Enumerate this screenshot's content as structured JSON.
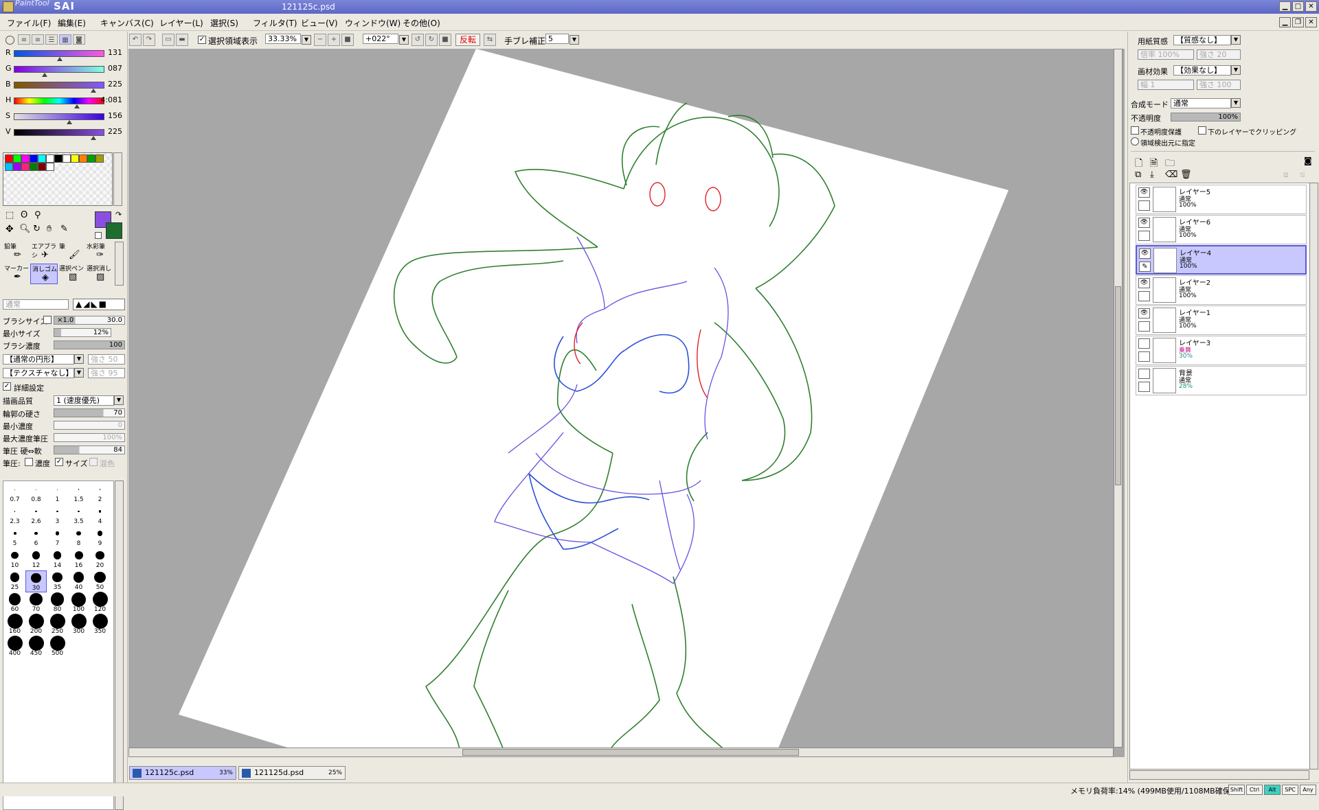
{
  "window": {
    "app_small": "PaintTool",
    "app_big": "SAI",
    "filename": "121125c.psd"
  },
  "menu": [
    "ファイル(F)",
    "編集(E)",
    "キャンバス(C)",
    "レイヤー(L)",
    "選択(S)",
    "フィルタ(T)",
    "ビュー(V)",
    "ウィンドウ(W)",
    "その他(O)"
  ],
  "toolbar": {
    "selection_label": "選択領域表示",
    "selection_checked": true,
    "zoom": "33.33%",
    "angle": "+022°",
    "flip": "反転",
    "stabilizer_label": "手ブレ補正",
    "stabilizer": "5"
  },
  "color": {
    "sliders": [
      {
        "label": "R",
        "value": "131",
        "pos": 0.51
      },
      {
        "label": "G",
        "value": "087",
        "pos": 0.34
      },
      {
        "label": "B",
        "value": "225",
        "pos": 0.88
      },
      {
        "label": "H",
        "value": "4:081",
        "pos": 0.7
      },
      {
        "label": "S",
        "value": "156",
        "pos": 0.61
      },
      {
        "label": "V",
        "value": "225",
        "pos": 0.88
      }
    ],
    "fg": "#8a4fe0",
    "bg": "#1d6e2f",
    "palette": [
      "#ff0000",
      "#00ff00",
      "#ff00ff",
      "#0000ff",
      "#00ffff",
      "#ffffff",
      "#000000",
      "#ffffff",
      "#ffff00",
      "#ff8000",
      "#00a000",
      "#a0a000",
      "#00c0ff",
      "#a000ff",
      "#ff2080",
      "#008000",
      "#800000",
      "#ffffff"
    ]
  },
  "tools": {
    "row1": [
      "鉛筆",
      "エアブラシ",
      "筆",
      "水彩筆"
    ],
    "row2": [
      "マーカー",
      "消しゴム",
      "選択ペン",
      "選択消し"
    ]
  },
  "brush": {
    "mode": "通常",
    "size_label": "ブラシサイズ",
    "size_mult": "×1.0",
    "size": "30.0",
    "min_size_label": "最小サイズ",
    "min_size": "12%",
    "density_label": "ブラシ濃度",
    "density": "100",
    "shape": "【通常の円形】",
    "shape_strength": "強さ 50",
    "texture": "【テクスチャなし】",
    "texture_strength": "強さ 95",
    "detail_label": "詳細設定",
    "quality_label": "描画品質",
    "quality": "1 (速度優先)",
    "hardness_label": "輪郭の硬さ",
    "hardness": "70",
    "min_density_label": "最小濃度",
    "min_density": "0",
    "max_pressure_label": "最大濃度筆圧",
    "max_pressure": "100%",
    "pressure_label": "筆圧 硬⇔軟",
    "pressure": "84",
    "pressure_opts_label": "筆圧:",
    "opt_density": "濃度",
    "opt_size": "サイズ",
    "opt_blend": "混色"
  },
  "brush_sizes": [
    "0.7",
    "0.8",
    "1",
    "1.5",
    "2",
    "2.3",
    "2.6",
    "3",
    "3.5",
    "4",
    "5",
    "6",
    "7",
    "8",
    "9",
    "10",
    "12",
    "14",
    "16",
    "20",
    "25",
    "30",
    "35",
    "40",
    "50",
    "60",
    "70",
    "80",
    "100",
    "120",
    "160",
    "200",
    "250",
    "300",
    "350",
    "400",
    "450",
    "500"
  ],
  "right": {
    "paper_label": "用紙質感",
    "paper": "【質感なし】",
    "paper_scale": "倍率 100%",
    "paper_strength": "強さ 20",
    "effect_label": "画材効果",
    "effect": "【効果なし】",
    "effect_width": "幅 1",
    "effect_strength": "強さ 100",
    "blend_label": "合成モード",
    "blend": "通常",
    "opacity_label": "不透明度",
    "opacity": "100%",
    "preserve_label": "不透明度保護",
    "clip_label": "下のレイヤーでクリッピング",
    "source_label": "領域検出元に指定"
  },
  "layers": [
    {
      "name": "レイヤー5",
      "mode": "通常",
      "opacity": "100%",
      "visible": true,
      "selected": false
    },
    {
      "name": "レイヤー6",
      "mode": "通常",
      "opacity": "100%",
      "visible": true,
      "selected": false
    },
    {
      "name": "レイヤー4",
      "mode": "通常",
      "opacity": "100%",
      "visible": true,
      "selected": true
    },
    {
      "name": "レイヤー2",
      "mode": "通常",
      "opacity": "100%",
      "visible": true,
      "selected": false
    },
    {
      "name": "レイヤー1",
      "mode": "通常",
      "opacity": "100%",
      "visible": true,
      "selected": false
    },
    {
      "name": "レイヤー3",
      "mode": "乗算",
      "opacity": "30%",
      "visible": false,
      "selected": false
    },
    {
      "name": "背景",
      "mode": "通常",
      "opacity": "28%",
      "visible": false,
      "selected": false
    }
  ],
  "tabs": [
    {
      "name": "121125c.psd",
      "zoom": "33%",
      "active": true
    },
    {
      "name": "121125d.psd",
      "zoom": "25%",
      "active": false
    }
  ],
  "status": {
    "memory": "メモリ負荷率:14% (499MB使用/1108MB確保)",
    "keys": [
      "Shift",
      "Ctrl",
      "Alt",
      "SPC",
      "Any"
    ]
  }
}
